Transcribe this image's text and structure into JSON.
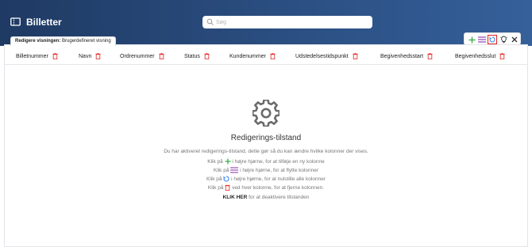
{
  "app": {
    "title": "Billetter",
    "icon": "ticket-icon"
  },
  "search": {
    "placeholder": "Søg"
  },
  "view_tab": {
    "prefix": "Redigere visningen:",
    "name": "Brugerdefineret visning"
  },
  "toolbar": {
    "buttons": [
      {
        "icon": "plus-icon",
        "color": "#3cae4a"
      },
      {
        "icon": "reorder-icon",
        "color": "#8e44ad"
      },
      {
        "icon": "reset-icon",
        "color": "#2f80ed",
        "highlighted": true
      },
      {
        "icon": "lightbulb-icon",
        "color": "#333333"
      },
      {
        "icon": "close-icon",
        "color": "#333333"
      }
    ],
    "highlight_color": "#e02020"
  },
  "columns": [
    "Billetnummer",
    "Navn",
    "Ordrenummer",
    "Status",
    "Kundenummer",
    "Udstedelsestidspunkt",
    "Begivenhedsstart",
    "Begivenhedsslut"
  ],
  "trash_color": "#e53935",
  "empty_state": {
    "icon": "gear-icon",
    "title": "Redigerings-tilstand",
    "intro": "Du har aktiveret redigerings-tilstand, dette gør så du kan ændre hvilke kolonner der vises.",
    "hint_add_before": "Klik på",
    "hint_add_after": "i højre hjørne, for at tilføje en ny kolonne",
    "hint_move_before": "Klik på",
    "hint_move_after": "i højre hjørne, for at flytte kolonner",
    "hint_reset_before": "Klik på",
    "hint_reset_after": "i højre hjørne, for at nulstille alle kolonner",
    "hint_remove_before": "Klik på",
    "hint_remove_after": "ved hver kolonne, for at fjerne kolonnen.",
    "click_here": "KLIK HER",
    "deactivate": "for at deaktivere tilstanden"
  }
}
